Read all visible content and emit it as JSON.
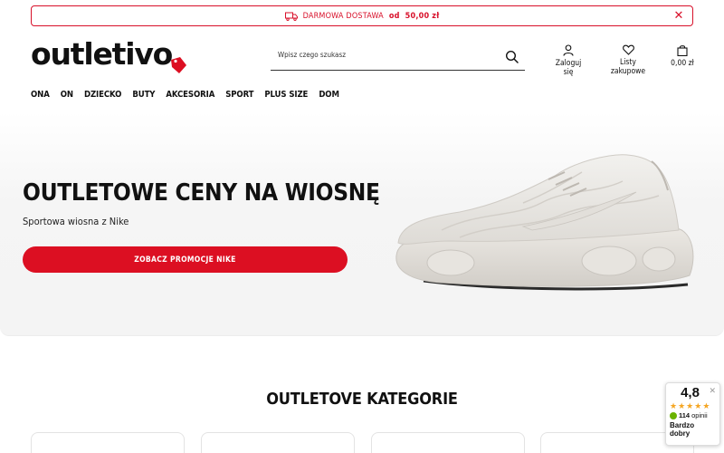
{
  "promo": {
    "text_prefix": "DARMOWA DOSTAWA",
    "text_od": "od",
    "amount": "50,00 zł",
    "close_icon": "✕"
  },
  "logo": {
    "text": "outletivo"
  },
  "search": {
    "placeholder": "Wpisz czego szukasz"
  },
  "header_actions": {
    "login": "Zaloguj się",
    "lists": "Listy zakupowe",
    "cart_total": "0,00 zł"
  },
  "nav": {
    "items": [
      "ONA",
      "ON",
      "DZIECKO",
      "BUTY",
      "AKCESORIA",
      "SPORT",
      "PLUS SIZE",
      "DOM"
    ]
  },
  "hero": {
    "title": "OUTLETOWE CENY NA WIOSNĘ",
    "subtitle": "Sportowa wiosna z Nike",
    "button": "ZOBACZ PROMOCJE NIKE"
  },
  "categories": {
    "title": "OUTLETOVE KATEGORIE"
  },
  "rating": {
    "score": "4,8",
    "close": "✕",
    "stars": 5,
    "count": "114",
    "count_label": "opinii",
    "label_line1": "Bardzo",
    "label_line2": "dobry"
  },
  "colors": {
    "brand_red": "#dc0f22",
    "star": "#f5a623",
    "check_green": "#6bb300"
  },
  "icons": {
    "truck": "truck-icon",
    "close": "close-icon",
    "search": "search-icon",
    "user": "user-icon",
    "heart": "heart-icon",
    "bag": "shopping-bag-icon",
    "star": "star-icon"
  }
}
